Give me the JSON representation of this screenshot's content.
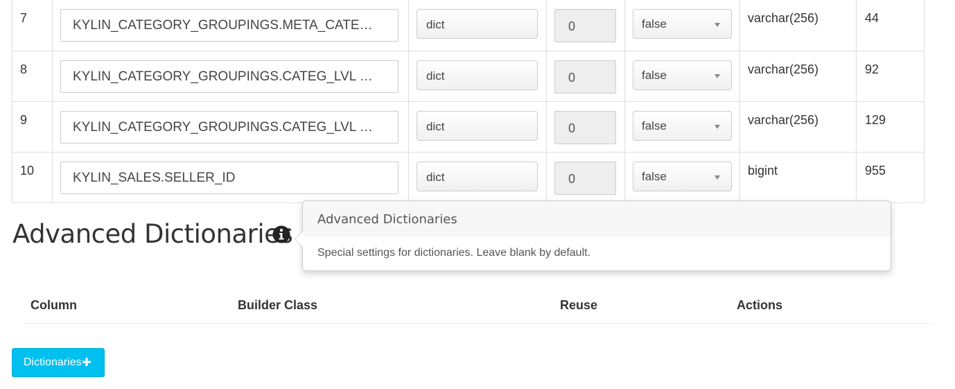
{
  "rowkey_table": {
    "rows": [
      {
        "index": "7",
        "column": "KYLIN_CATEGORY_GROUPINGS.META_CATE…",
        "encoding": "dict",
        "length": "0",
        "shard_by": "false",
        "data_type": "varchar(256)",
        "cardinality": "44"
      },
      {
        "index": "8",
        "column": "KYLIN_CATEGORY_GROUPINGS.CATEG_LVL …",
        "encoding": "dict",
        "length": "0",
        "shard_by": "false",
        "data_type": "varchar(256)",
        "cardinality": "92"
      },
      {
        "index": "9",
        "column": "KYLIN_CATEGORY_GROUPINGS.CATEG_LVL …",
        "encoding": "dict",
        "length": "0",
        "shard_by": "false",
        "data_type": "varchar(256)",
        "cardinality": "129"
      },
      {
        "index": "10",
        "column": "KYLIN_SALES.SELLER_ID",
        "encoding": "dict",
        "length": "0",
        "shard_by": "false",
        "data_type": "bigint",
        "cardinality": "955"
      }
    ]
  },
  "advanced_dictionaries": {
    "title": "Advanced Dictionaries",
    "info_icon": "info-circle-icon",
    "popover": {
      "title": "Advanced Dictionaries",
      "content": "Special settings for dictionaries. Leave blank by default."
    },
    "columns": [
      "Column",
      "Builder Class",
      "Reuse",
      "Actions"
    ],
    "add_button": {
      "label": "Dictionaries",
      "icon": "plus-icon",
      "color": "#00c0ef"
    }
  }
}
